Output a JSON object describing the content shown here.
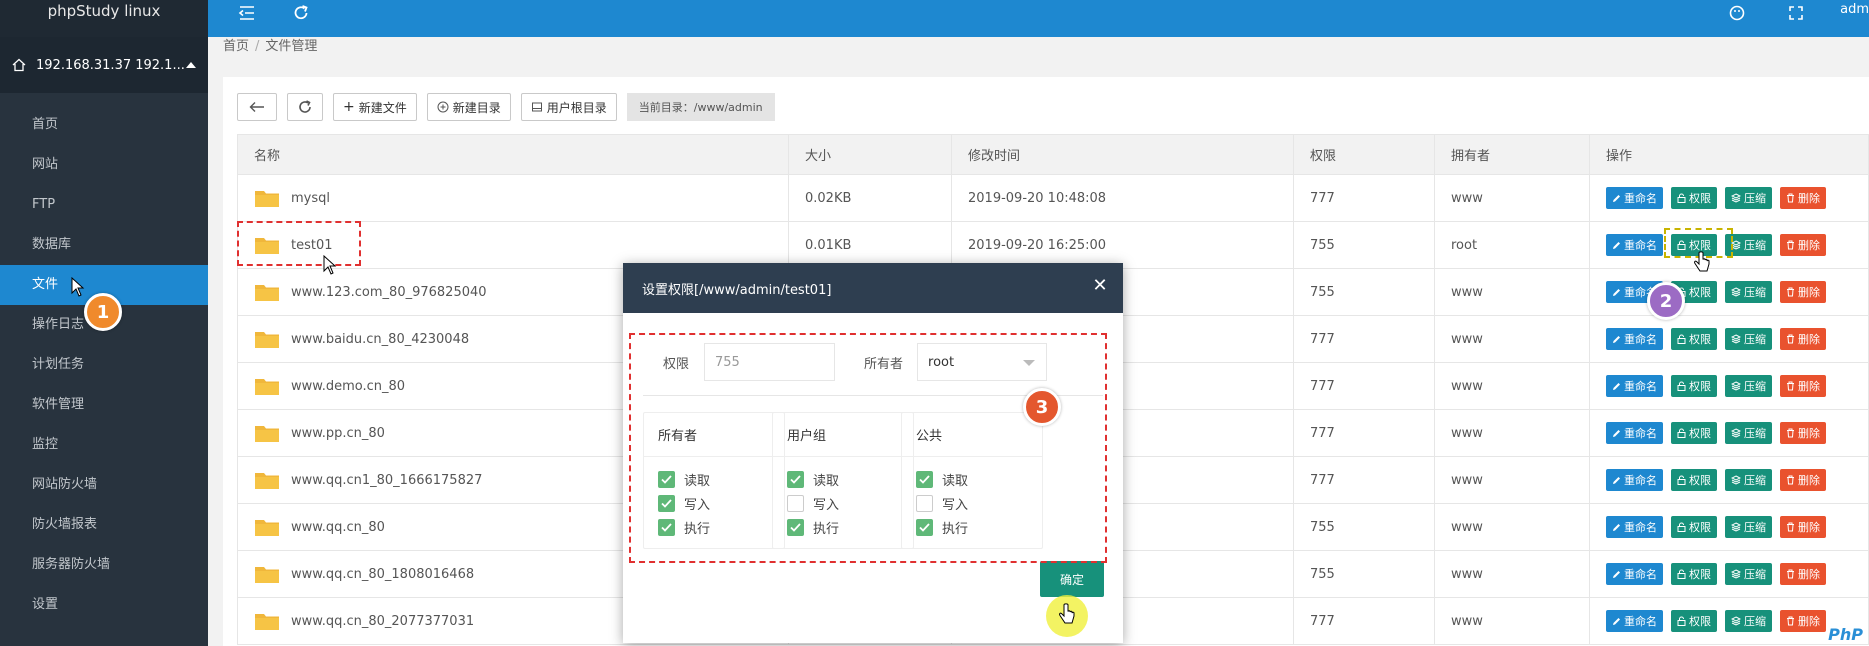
{
  "app": {
    "title": "phpStudy linux"
  },
  "sidebar": {
    "server_label": "192.168.31.37 192.1...",
    "items": [
      {
        "label": "首页"
      },
      {
        "label": "网站"
      },
      {
        "label": "FTP"
      },
      {
        "label": "数据库"
      },
      {
        "label": "文件"
      },
      {
        "label": "操作日志"
      },
      {
        "label": "计划任务"
      },
      {
        "label": "软件管理"
      },
      {
        "label": "监控"
      },
      {
        "label": "网站防火墙"
      },
      {
        "label": "防火墙报表"
      },
      {
        "label": "服务器防火墙"
      },
      {
        "label": "设置"
      }
    ]
  },
  "header": {
    "user": "adm"
  },
  "breadcrumb": {
    "home": "首页",
    "separator": "/",
    "current": "文件管理"
  },
  "toolbar": {
    "new_file": "新建文件",
    "new_dir": "新建目录",
    "user_root": "用户根目录",
    "current_dir": "当前目录：/www/admin"
  },
  "table": {
    "headers": [
      "名称",
      "大小",
      "修改时间",
      "权限",
      "拥有者",
      "操作"
    ],
    "rows": [
      {
        "name": "mysql",
        "size": "0.02KB",
        "mtime": "2019-09-20 10:48:08",
        "perm": "777",
        "owner": "www"
      },
      {
        "name": "test01",
        "size": "0.01KB",
        "mtime": "2019-09-20 16:25:00",
        "perm": "755",
        "owner": "root"
      },
      {
        "name": "www.123.com_80_976825040",
        "size": "",
        "mtime": "",
        "perm": "755",
        "owner": "www"
      },
      {
        "name": "www.baidu.cn_80_4230048",
        "size": "",
        "mtime": "",
        "perm": "777",
        "owner": "www"
      },
      {
        "name": "www.demo.cn_80",
        "size": "",
        "mtime": "",
        "perm": "777",
        "owner": "www"
      },
      {
        "name": "www.pp.cn_80",
        "size": "",
        "mtime": "",
        "perm": "777",
        "owner": "www"
      },
      {
        "name": "www.qq.cn1_80_1666175827",
        "size": "",
        "mtime": "",
        "perm": "777",
        "owner": "www"
      },
      {
        "name": "www.qq.cn_80",
        "size": "",
        "mtime": "",
        "perm": "755",
        "owner": "www"
      },
      {
        "name": "www.qq.cn_80_1808016468",
        "size": "",
        "mtime": "",
        "perm": "755",
        "owner": "www"
      },
      {
        "name": "www.qq.cn_80_2077377031",
        "size": "",
        "mtime": "",
        "perm": "777",
        "owner": "www"
      }
    ],
    "ops": {
      "rename": "重命名",
      "perm": "权限",
      "zip": "压缩",
      "del": "删除"
    }
  },
  "badges": [
    "1",
    "2",
    "3"
  ],
  "dialog": {
    "title": "设置权限[/www/admin/test01]",
    "perm_label": "权限",
    "perm_placeholder": "755",
    "owner_label": "所有者",
    "owner_value": "root",
    "groups": [
      {
        "title": "所有者",
        "items": [
          {
            "label": "读取",
            "checked": true
          },
          {
            "label": "写入",
            "checked": true
          },
          {
            "label": "执行",
            "checked": true
          }
        ]
      },
      {
        "title": "用户组",
        "items": [
          {
            "label": "读取",
            "checked": true
          },
          {
            "label": "写入",
            "checked": false
          },
          {
            "label": "执行",
            "checked": true
          }
        ]
      },
      {
        "title": "公共",
        "items": [
          {
            "label": "读取",
            "checked": true
          },
          {
            "label": "写入",
            "checked": false
          },
          {
            "label": "执行",
            "checked": true
          }
        ]
      }
    ],
    "confirm": "确定"
  },
  "watermark": "PhP"
}
